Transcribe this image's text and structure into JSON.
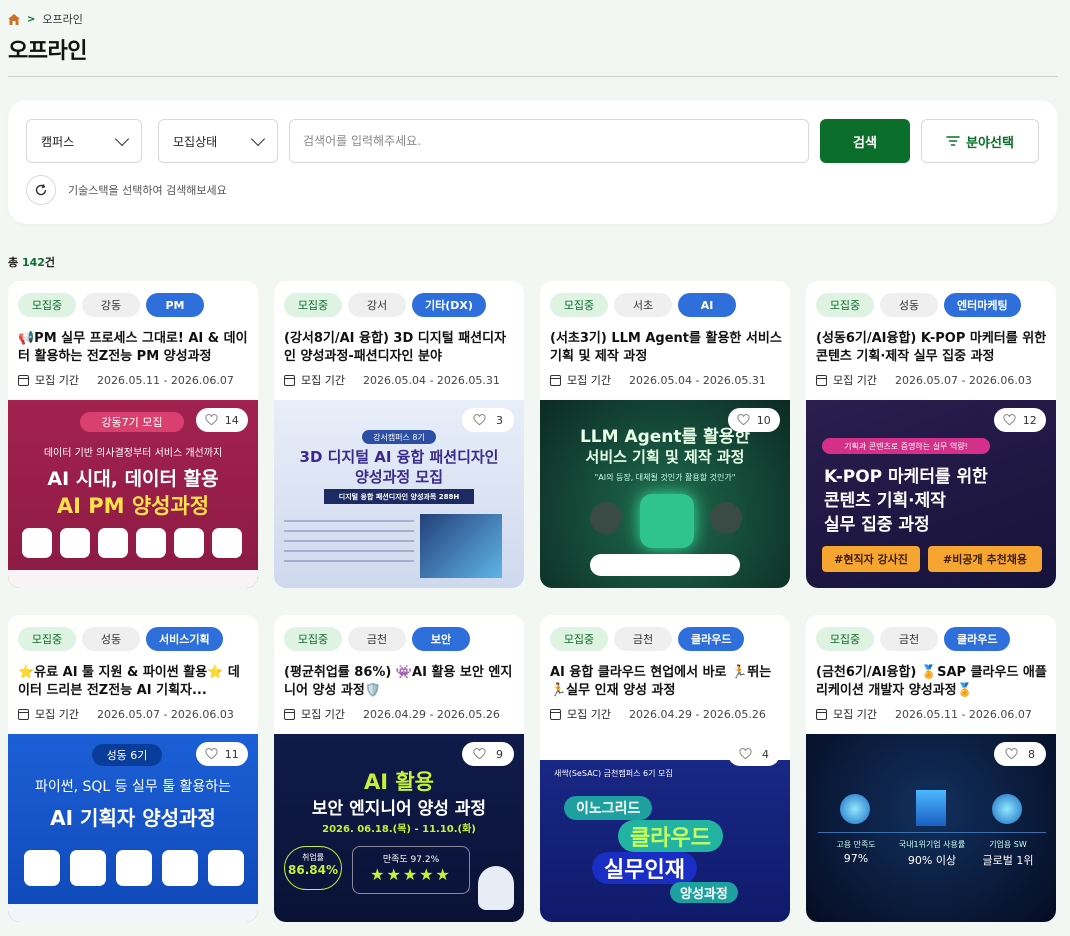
{
  "breadcrumb": {
    "current": "오프라인",
    "separator": ">"
  },
  "page_title": "오프라인",
  "filters": {
    "campus": "캠퍼스",
    "status": "모집상태",
    "search_placeholder": "검색어를 입력해주세요.",
    "search_button": "검색",
    "field_button": "분야선택",
    "hint": "기술스택을 선택하여 검색해보세요"
  },
  "total": {
    "prefix": "총 ",
    "count": "142",
    "suffix": "건"
  },
  "period_label": "모집 기간",
  "cards": [
    {
      "status": "모집중",
      "campus": "강동",
      "field": "PM",
      "title": "📢PM 실무 프로세스 그대로! AI & 데이터 활용하는 전Z전능 PM 양성과정",
      "period": "2026.05.11 - 2026.06.07",
      "likes": "14",
      "banner": {
        "badge": "강동7기 모집",
        "line1": "데이터 기반 의사결정부터 서비스 개선까지",
        "line2": "AI 시대, 데이터 활용",
        "line3": "AI PM 양성과정"
      }
    },
    {
      "status": "모집중",
      "campus": "강서",
      "field": "기타(DX)",
      "title": "(강서8기/AI 융합) 3D 디지털 패션디자인 양성과정-패션디자인 분야",
      "period": "2026.05.04 - 2026.05.31",
      "likes": "3",
      "banner": {
        "badge": "강서캠퍼스 8기",
        "line1": "3D 디지털 AI 융합 패션디자인",
        "line2": "양성과정 모집",
        "line3": "디지털 융합 패션디자인 양성과목 288H"
      }
    },
    {
      "status": "모집중",
      "campus": "서초",
      "field": "AI",
      "title": "(서초3기) LLM Agent를 활용한 서비스 기획 및 제작 과정",
      "period": "2026.05.04 - 2026.05.31",
      "likes": "10",
      "banner": {
        "line1": "LLM Agent를 활용한",
        "line2": "서비스 기획 및 제작 과정",
        "line3": "\"AI의 등장, 대체될 것인가 활용할 것인가\""
      }
    },
    {
      "status": "모집중",
      "campus": "성동",
      "field": "엔터마케팅",
      "title": "(성동6기/AI융합) K-POP 마케터를 위한 콘텐츠 기획·제작 실무 집중 과정",
      "period": "2026.05.07 - 2026.06.03",
      "likes": "12",
      "banner": {
        "badge": "기획과 콘텐츠로 증명하는 실무 역량!",
        "line1": "K-POP 마케터를 위한",
        "line2": "콘텐츠 기획·제작",
        "line3": "실무 집중 과정",
        "chip1": "#현직자 강사진",
        "chip2": "#비공개 추천채용"
      }
    },
    {
      "status": "모집중",
      "campus": "성동",
      "field": "서비스기획",
      "title": "⭐유료 AI 툴 지원 & 파이썬 활용⭐ 데이터 드리븐 전Z전능 AI 기획자...",
      "period": "2026.05.07 - 2026.06.03",
      "likes": "11",
      "banner": {
        "badge": "성동 6기",
        "line1": "파이썬, SQL 등 실무 툴 활용하는",
        "line2": "AI 기획자 양성과정"
      }
    },
    {
      "status": "모집중",
      "campus": "금천",
      "field": "보안",
      "title": "(평균취업률 86%) 👾AI 활용 보안 엔지니어 양성 과정🛡️",
      "period": "2026.04.29 - 2026.05.26",
      "likes": "9",
      "banner": {
        "line1": "AI 활용",
        "line2": "보안 엔지니어 양성 과정",
        "line3": "2026. 06.18.(목) - 11.10.(화)",
        "stat1_label": "취업률",
        "stat1": "86.84%",
        "stat2_label": "만족도 97.2%"
      }
    },
    {
      "status": "모집중",
      "campus": "금천",
      "field": "클라우드",
      "title": "AI 융합 클라우드 현업에서 바로 🏃뛰는 🏃실무 인재 양성 과정",
      "period": "2026.04.29 - 2026.05.26",
      "likes": "4",
      "banner": {
        "line0": "새싹(SeSAC) 금천캠퍼스 6기 모집",
        "line1": "이노그리드",
        "line2": "클라우드",
        "line3": "실무인재",
        "line4": "양성과정"
      }
    },
    {
      "status": "모집중",
      "campus": "금천",
      "field": "클라우드",
      "title": "(금천6기/AI융합) 🏅SAP 클라우드 애플리케이션 개발자 양성과정🏅",
      "period": "2026.05.11 - 2026.06.07",
      "likes": "8",
      "banner": {
        "s1": "고용 만족도",
        "v1": "97%",
        "s2": "국내1위기업 사용률",
        "v2": "90% 이상",
        "s3": "기업용 SW",
        "v3": "글로벌 1위"
      }
    }
  ],
  "colors": {
    "brand": "#0b6e2a",
    "tag_status_bg": "#dff3e2",
    "tag_field_bg": "#2f6fdc"
  }
}
